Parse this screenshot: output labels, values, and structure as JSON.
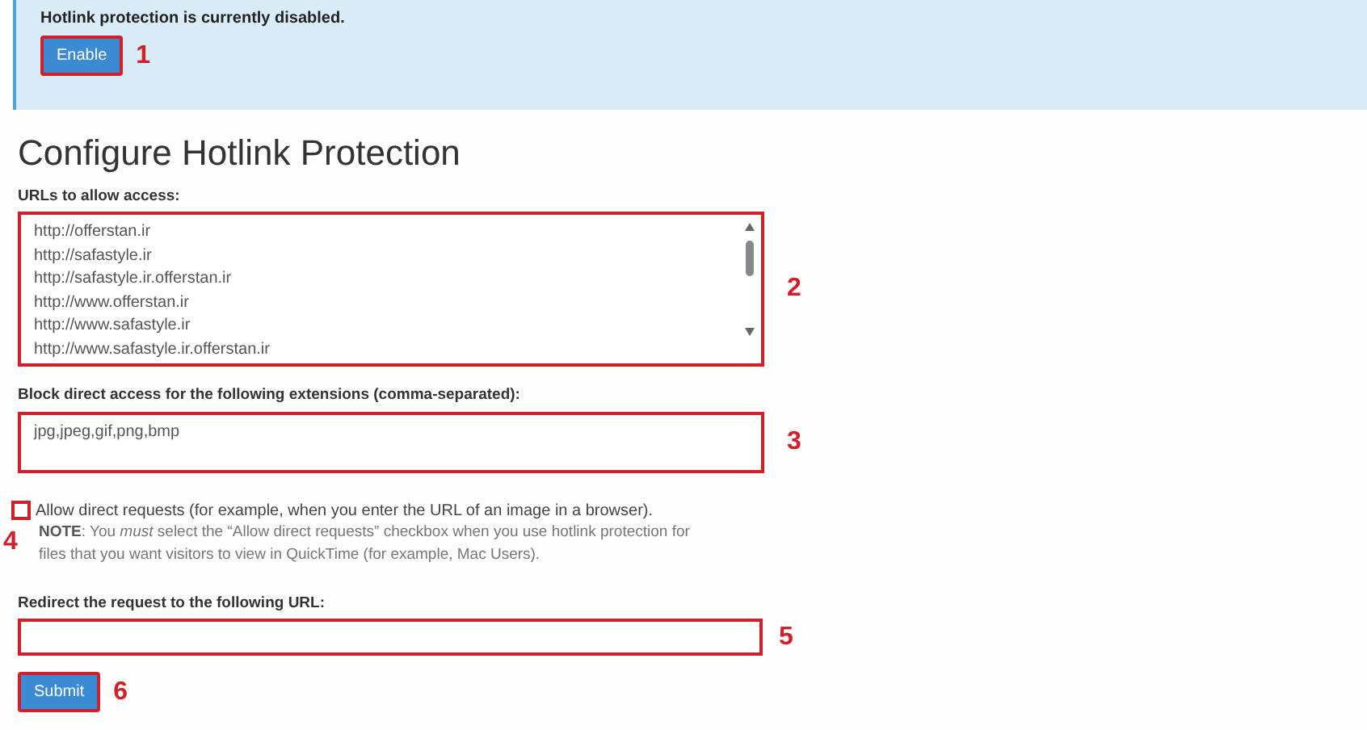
{
  "alert": {
    "message": "Hotlink protection is currently disabled.",
    "button": {
      "label": "Enable",
      "annotation": "1"
    }
  },
  "heading": "Configure Hotlink Protection",
  "urls": {
    "label": "URLs to allow access:",
    "annotation": "2",
    "lines": [
      "http://offerstan.ir",
      "http://safastyle.ir",
      "http://safastyle.ir.offerstan.ir",
      "http://www.offerstan.ir",
      "http://www.safastyle.ir",
      "http://www.safastyle.ir.offerstan.ir"
    ]
  },
  "extensions": {
    "label": "Block direct access for the following extensions (comma-separated):",
    "value": "jpg,jpeg,gif,png,bmp",
    "annotation": "3"
  },
  "allow_direct": {
    "label": "Allow direct requests (for example, when you enter the URL of an image in a browser).",
    "checked": false,
    "annotation": "4",
    "note": "**NOTE**: You *must* select the “Allow direct requests” checkbox when you use hotlink protection for files that you want visitors to view in QuickTime (for example, Mac Users)."
  },
  "redirect": {
    "label": "Redirect the request to the following URL:",
    "annotation": "5"
  },
  "submit": {
    "label": "Submit",
    "annotation": "6"
  }
}
